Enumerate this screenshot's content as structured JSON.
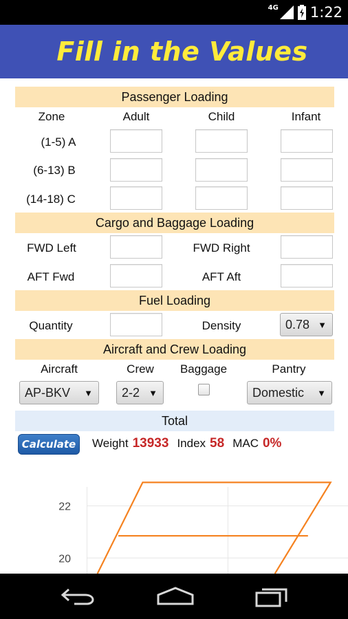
{
  "status_bar": {
    "network": "4G",
    "time": "1:22"
  },
  "header": {
    "title": "Fill in the Values"
  },
  "passenger": {
    "title": "Passenger Loading",
    "columns": {
      "zone": "Zone",
      "adult": "Adult",
      "child": "Child",
      "infant": "Infant"
    },
    "rows": [
      {
        "zone": "(1-5) A",
        "adult": "",
        "child": "",
        "infant": ""
      },
      {
        "zone": "(6-13) B",
        "adult": "",
        "child": "",
        "infant": ""
      },
      {
        "zone": "(14-18) C",
        "adult": "",
        "child": "",
        "infant": ""
      }
    ]
  },
  "cargo": {
    "title": "Cargo and Baggage Loading",
    "fwd_left": "FWD Left",
    "fwd_right": "FWD Right",
    "aft_fwd": "AFT Fwd",
    "aft_aft": "AFT Aft"
  },
  "fuel": {
    "title": "Fuel Loading",
    "quantity_label": "Quantity",
    "density_label": "Density",
    "density_value": "0.78"
  },
  "crew": {
    "title": "Aircraft and Crew Loading",
    "aircraft_label": "Aircraft",
    "crew_label": "Crew",
    "baggage_label": "Baggage",
    "pantry_label": "Pantry",
    "aircraft_value": "AP-BKV",
    "crew_value": "2-2",
    "baggage_checked": false,
    "pantry_value": "Domestic"
  },
  "total": {
    "title": "Total",
    "calculate_label": "Calculate",
    "weight_label": "Weight",
    "weight_value": "13933",
    "index_label": "Index",
    "index_value": "58",
    "mac_label": "MAC",
    "mac_value": "0%"
  },
  "chart_data": {
    "type": "line",
    "y_tick_labels": [
      "22",
      "20"
    ],
    "ylim": [
      19.4,
      23.2
    ],
    "xlim": [
      0,
      1
    ],
    "grid": true,
    "series": [
      {
        "color": "#f58220",
        "points": [
          [
            0.28,
            19.4
          ],
          [
            0.41,
            22.9
          ],
          [
            0.95,
            22.9
          ],
          [
            0.79,
            19.4
          ]
        ]
      },
      {
        "color": "#f58220",
        "points": [
          [
            0.34,
            20.85
          ],
          [
            0.885,
            20.85
          ]
        ]
      }
    ]
  },
  "colors": {
    "header_bg": "#3f51b5",
    "header_title": "#ffeb3b",
    "section_bg": "#fde4b5",
    "total_bg": "#e3edf9",
    "value_red": "#c62828",
    "chart_line": "#f58220"
  },
  "nav": {
    "icons": [
      "back-icon",
      "home-icon",
      "recent-apps-icon"
    ]
  }
}
